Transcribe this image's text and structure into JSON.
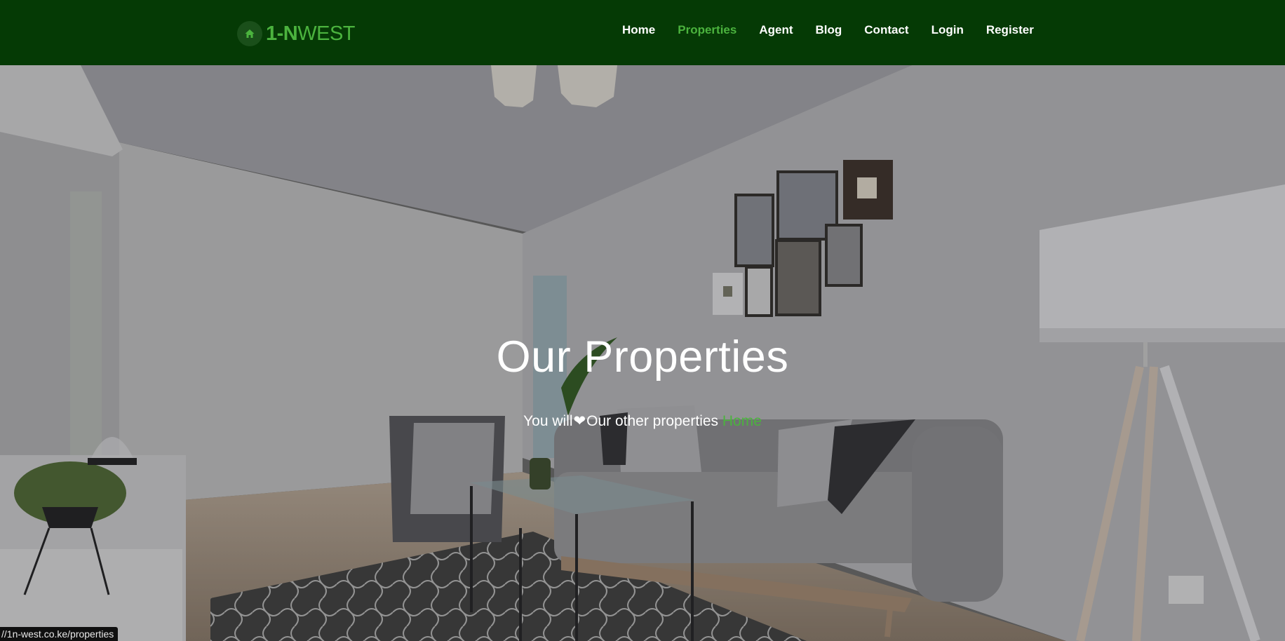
{
  "brand": {
    "bold": "1-N",
    "light": "WEST",
    "icon": "home-icon",
    "accent": "#4bb33e",
    "header_bg": "#053a05"
  },
  "nav": {
    "items": [
      {
        "label": "Home"
      },
      {
        "label": "Properties",
        "active": true
      },
      {
        "label": "Agent"
      },
      {
        "label": "Blog"
      },
      {
        "label": "Contact"
      },
      {
        "label": "Login"
      },
      {
        "label": "Register"
      }
    ]
  },
  "hero": {
    "title": "Our Properties",
    "subtitle_part1": "You will",
    "heart": "❤",
    "subtitle_part2": "Our other properties",
    "crumb_link": "Home"
  },
  "status_url": "//1n-west.co.ke/properties"
}
